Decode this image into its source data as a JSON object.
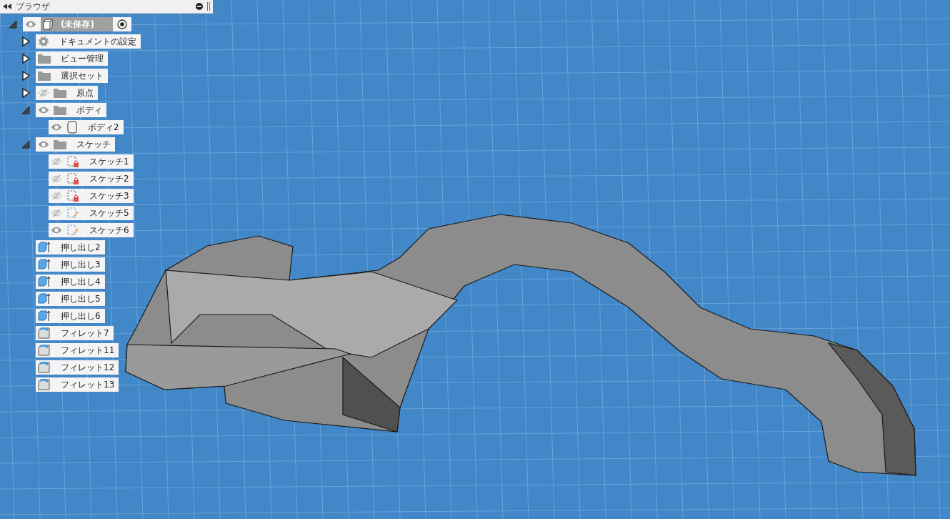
{
  "browser": {
    "title": "ブラウザ",
    "tree": [
      {
        "kind": "root",
        "label": "(未保存)",
        "expanded": true,
        "visible": true,
        "children": [
          {
            "kind": "settings",
            "label": "ドキュメントの設定",
            "expanded": false
          },
          {
            "kind": "folder",
            "label": "ビュー管理",
            "expanded": false
          },
          {
            "kind": "folder",
            "label": "選択セット",
            "expanded": false
          },
          {
            "kind": "folder",
            "label": "原点",
            "expanded": false,
            "visible": false
          },
          {
            "kind": "folder",
            "label": "ボディ",
            "expanded": true,
            "visible": true,
            "children": [
              {
                "kind": "body",
                "label": "ボディ2",
                "visible": true
              }
            ]
          },
          {
            "kind": "folder",
            "label": "スケッチ",
            "expanded": true,
            "visible": true,
            "children": [
              {
                "kind": "sketch",
                "label": "スケッチ1",
                "visible": false,
                "locked": true
              },
              {
                "kind": "sketch",
                "label": "スケッチ2",
                "visible": false,
                "locked": true
              },
              {
                "kind": "sketch",
                "label": "スケッチ3",
                "visible": false,
                "locked": true
              },
              {
                "kind": "sketch",
                "label": "スケッチ5",
                "visible": false,
                "locked": false
              },
              {
                "kind": "sketch",
                "label": "スケッチ6",
                "visible": true,
                "locked": false
              }
            ]
          },
          {
            "kind": "extrude",
            "label": "押し出し2"
          },
          {
            "kind": "extrude",
            "label": "押し出し3"
          },
          {
            "kind": "extrude",
            "label": "押し出し4"
          },
          {
            "kind": "extrude",
            "label": "押し出し5"
          },
          {
            "kind": "extrude",
            "label": "押し出し6"
          },
          {
            "kind": "fillet",
            "label": "フィレット7"
          },
          {
            "kind": "fillet",
            "label": "フィレット11"
          },
          {
            "kind": "fillet",
            "label": "フィレット12"
          },
          {
            "kind": "fillet",
            "label": "フィレット13"
          }
        ]
      }
    ]
  }
}
